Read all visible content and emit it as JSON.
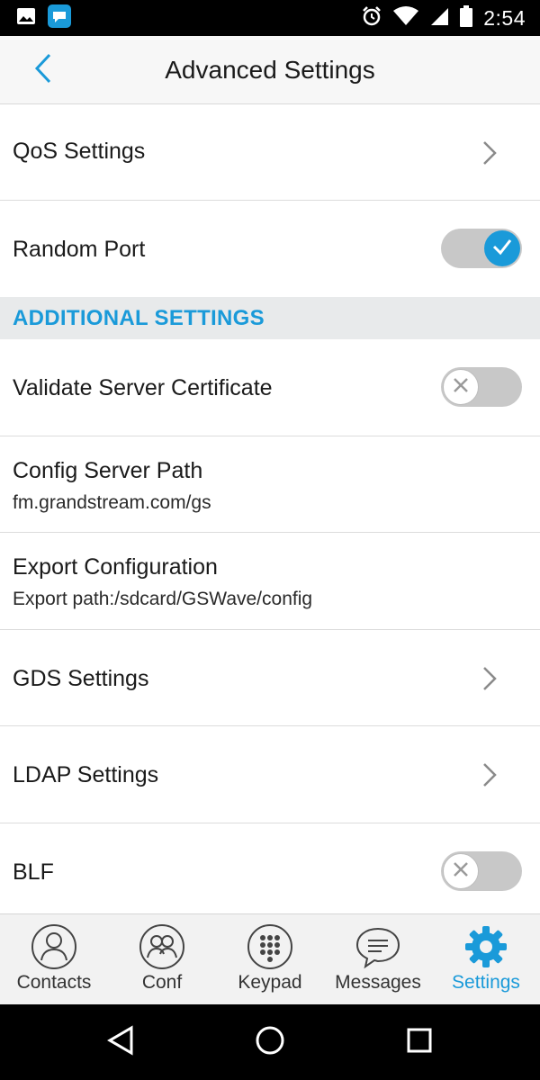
{
  "status_bar": {
    "time": "2:54",
    "left_icons": [
      "image-icon",
      "app-notification-icon"
    ],
    "right_icons": [
      "alarm-icon",
      "wifi-icon",
      "signal-icon",
      "battery-icon"
    ]
  },
  "header": {
    "title": "Advanced Settings",
    "back_icon": "chevron-left-icon"
  },
  "settings": {
    "qos": {
      "label": "QoS Settings"
    },
    "random_port": {
      "label": "Random Port",
      "enabled": true
    },
    "section_additional": {
      "title": "ADDITIONAL SETTINGS"
    },
    "validate_cert": {
      "label": "Validate Server Certificate",
      "enabled": false
    },
    "config_path": {
      "label": "Config Server Path",
      "value": "fm.grandstream.com/gs"
    },
    "export_config": {
      "label": "Export Configuration",
      "value": "Export path:/sdcard/GSWave/config"
    },
    "gds": {
      "label": "GDS Settings"
    },
    "ldap": {
      "label": "LDAP Settings"
    },
    "blf": {
      "label": "BLF",
      "enabled": false
    }
  },
  "tabs": [
    {
      "label": "Contacts",
      "icon": "contacts-icon",
      "active": false
    },
    {
      "label": "Conf",
      "icon": "conference-icon",
      "active": false
    },
    {
      "label": "Keypad",
      "icon": "keypad-icon",
      "active": false
    },
    {
      "label": "Messages",
      "icon": "messages-icon",
      "active": false
    },
    {
      "label": "Settings",
      "icon": "gear-icon",
      "active": true
    }
  ],
  "colors": {
    "accent": "#1a9ad9",
    "section_bg": "#e8eaeb",
    "toggle_track": "#c8c8c8"
  },
  "nav": {
    "buttons": [
      "back-triangle-icon",
      "home-circle-icon",
      "recents-square-icon"
    ]
  }
}
